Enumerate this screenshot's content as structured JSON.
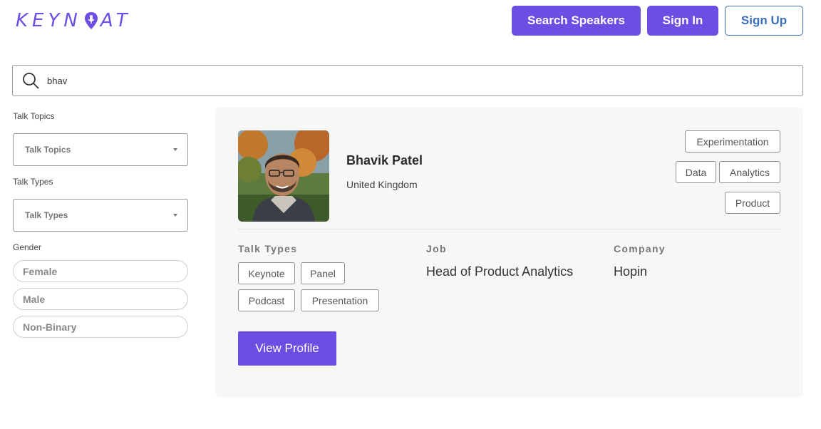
{
  "header": {
    "logo_text_left": "KEYN",
    "logo_text_right": "AT",
    "search_speakers_label": "Search Speakers",
    "sign_in_label": "Sign In",
    "sign_up_label": "Sign Up"
  },
  "search": {
    "value": "bhav"
  },
  "filters": {
    "talk_topics_label": "Talk Topics",
    "talk_topics_select": "Talk Topics",
    "talk_types_label": "Talk Types",
    "talk_types_select": "Talk Types",
    "gender_label": "Gender",
    "genders": [
      "Female",
      "Male",
      "Non-Binary"
    ]
  },
  "speaker": {
    "name": "Bhavik Patel",
    "country": "United Kingdom",
    "topics": [
      "Experimentation",
      "Data",
      "Analytics",
      "Product"
    ],
    "talk_types_label": "Talk Types",
    "talk_types": [
      "Keynote",
      "Panel",
      "Podcast",
      "Presentation"
    ],
    "job_label": "Job",
    "job": "Head of Product Analytics",
    "company_label": "Company",
    "company": "Hopin",
    "view_profile_label": "View Profile"
  },
  "colors": {
    "brand": "#6c4ee3",
    "outline_blue": "#3b6fb6",
    "card_bg": "#f7f7f7"
  }
}
